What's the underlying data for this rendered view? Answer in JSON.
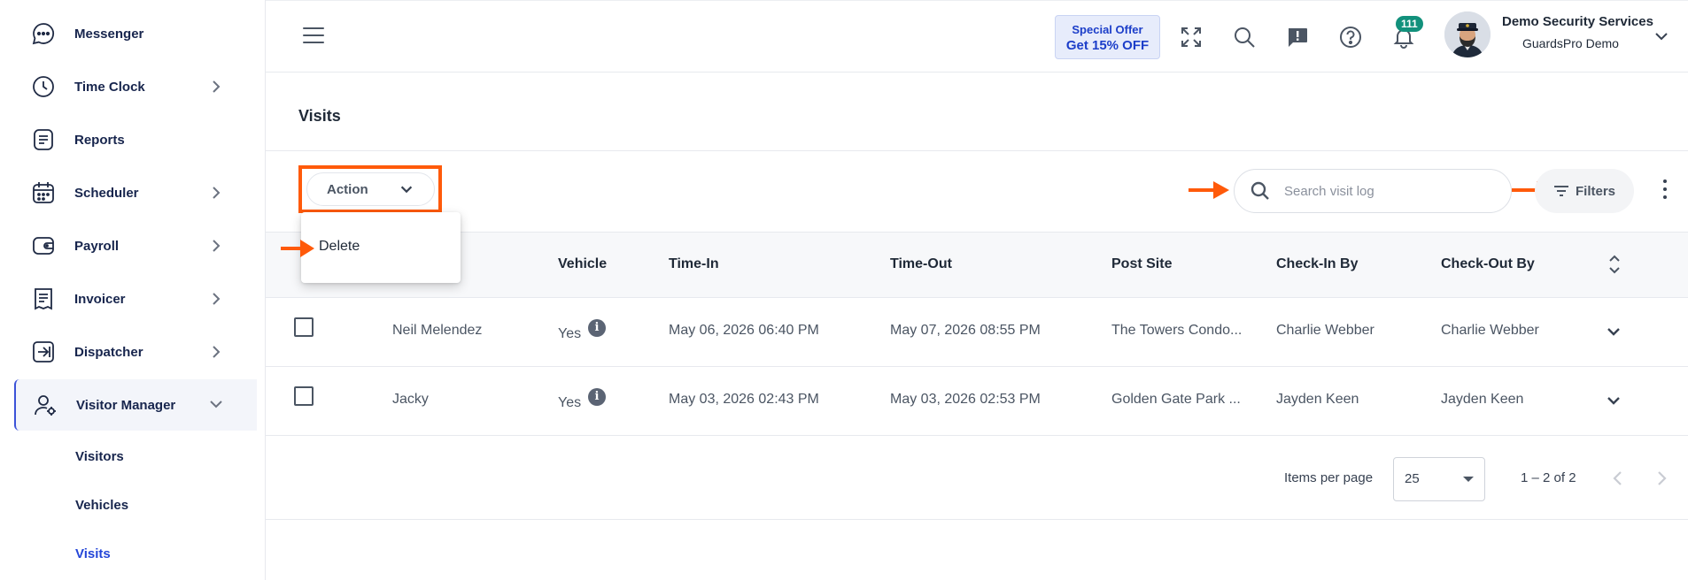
{
  "sidebar": {
    "items": [
      {
        "label": "Messenger",
        "icon": "chat-icon",
        "has_submenu": false
      },
      {
        "label": "Time Clock",
        "icon": "clock-icon",
        "has_submenu": true
      },
      {
        "label": "Reports",
        "icon": "report-icon",
        "has_submenu": false
      },
      {
        "label": "Scheduler",
        "icon": "calendar-icon",
        "has_submenu": true
      },
      {
        "label": "Payroll",
        "icon": "wallet-icon",
        "has_submenu": true
      },
      {
        "label": "Invoicer",
        "icon": "invoice-icon",
        "has_submenu": true
      },
      {
        "label": "Dispatcher",
        "icon": "dispatch-icon",
        "has_submenu": true
      },
      {
        "label": "Visitor Manager",
        "icon": "visitor-icon",
        "has_submenu": true,
        "expanded": true
      }
    ],
    "subitems": [
      {
        "label": "Visitors"
      },
      {
        "label": "Vehicles"
      },
      {
        "label": "Visits",
        "current": true
      }
    ]
  },
  "header": {
    "offer_line1": "Special Offer",
    "offer_line2": "Get 15% OFF",
    "notification_count": "111",
    "user_name": "Demo Security Services",
    "user_org": "GuardsPro Demo"
  },
  "page": {
    "title": "Visits",
    "action_label": "Action",
    "search_placeholder": "Search visit log",
    "filters_label": "Filters"
  },
  "action_menu": {
    "items": [
      "Delete"
    ]
  },
  "table": {
    "columns": [
      "Vehicle",
      "Time-In",
      "Time-Out",
      "Post Site",
      "Check-In By",
      "Check-Out By"
    ],
    "rows": [
      {
        "name": "Neil Melendez",
        "vehicle": "Yes",
        "time_in": "May 06, 2026 06:40 PM",
        "time_out": "May 07, 2026 08:55 PM",
        "post_site": "The Towers Condo...",
        "check_in_by": "Charlie Webber",
        "check_out_by": "Charlie Webber"
      },
      {
        "name": "Jacky",
        "vehicle": "Yes",
        "time_in": "May 03, 2026 02:43 PM",
        "time_out": "May 03, 2026 02:53 PM",
        "post_site": "Golden Gate Park ...",
        "check_in_by": "Jayden Keen",
        "check_out_by": "Jayden Keen"
      }
    ]
  },
  "pagination": {
    "items_per_page_label": "Items per page",
    "items_per_page": "25",
    "range": "1 – 2 of 2"
  },
  "colors": {
    "accent": "#2446d8",
    "highlight": "#ff5a0a",
    "badge": "#12917c"
  }
}
